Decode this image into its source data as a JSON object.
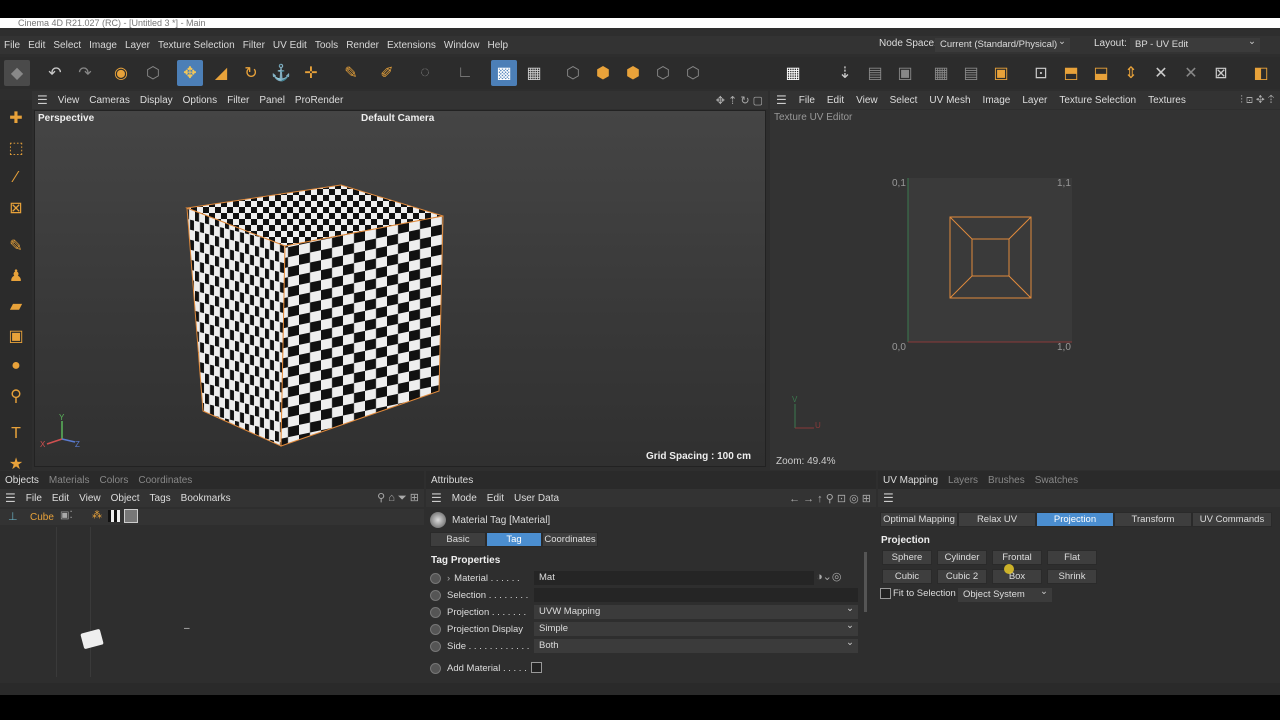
{
  "title": "Cinema 4D R21.027 (RC) - [Untitled 3 *] - Main",
  "menu": [
    "File",
    "Edit",
    "Select",
    "Image",
    "Layer",
    "Texture Selection",
    "Filter",
    "UV Edit",
    "Tools",
    "Render",
    "Extensions",
    "Window",
    "Help"
  ],
  "nodespace": {
    "label": "Node Space:",
    "value": "Current (Standard/Physical)"
  },
  "layout": {
    "label": "Layout:",
    "value": "BP - UV Edit"
  },
  "viewport": {
    "menu": [
      "View",
      "Cameras",
      "Display",
      "Options",
      "Filter",
      "Panel",
      "ProRender"
    ],
    "name": "Perspective",
    "camera": "Default Camera",
    "grid": "Grid Spacing : 100 cm"
  },
  "uv": {
    "menu": [
      "File",
      "Edit",
      "View",
      "Select",
      "UV Mesh",
      "Image",
      "Layer",
      "Texture Selection",
      "Textures"
    ],
    "title": "Texture UV Editor",
    "c01": "0,1",
    "c11": "1,1",
    "c00": "0,0",
    "c10": "1,0",
    "zoom": "Zoom: 49.4%"
  },
  "objects": {
    "tabs": [
      "Objects",
      "Materials",
      "Colors",
      "Coordinates"
    ],
    "menu": [
      "File",
      "Edit",
      "View",
      "Object",
      "Tags",
      "Bookmarks"
    ],
    "cube": "Cube",
    "dash": "–"
  },
  "attributes": {
    "tab": "Attributes",
    "menu": [
      "Mode",
      "Edit",
      "User Data"
    ],
    "header": "Material Tag [Material]",
    "subtabs": [
      "Basic",
      "Tag",
      "Coordinates"
    ],
    "section": "Tag Properties",
    "rows": [
      {
        "label": "Material . . . . . .",
        "value": "Mat"
      },
      {
        "label": "Selection . . . . . . . .",
        "value": ""
      },
      {
        "label": "Projection . . . . . . .",
        "value": "UVW Mapping"
      },
      {
        "label": "Projection Display",
        "value": "Simple"
      },
      {
        "label": "Side . . . . . . . . . . . .",
        "value": "Both"
      },
      {
        "label": "Add Material . . . . .",
        "value": ""
      }
    ]
  },
  "uvmapping": {
    "tabs": [
      "UV Mapping",
      "Layers",
      "Brushes",
      "Swatches"
    ],
    "subtabs": [
      "Optimal Mapping",
      "Relax UV",
      "Projection",
      "Transform",
      "UV Commands"
    ],
    "section": "Projection",
    "row1": [
      "Sphere",
      "Cylinder",
      "Frontal",
      "Flat"
    ],
    "row2": [
      "Cubic",
      "Cubic 2",
      "Box",
      "Shrink"
    ],
    "fit": "Fit to Selection",
    "system": "Object System"
  },
  "colors": {
    "accent": "#4b8ed0",
    "highlight": "#e8a23a",
    "selection": "#e08a3c"
  }
}
